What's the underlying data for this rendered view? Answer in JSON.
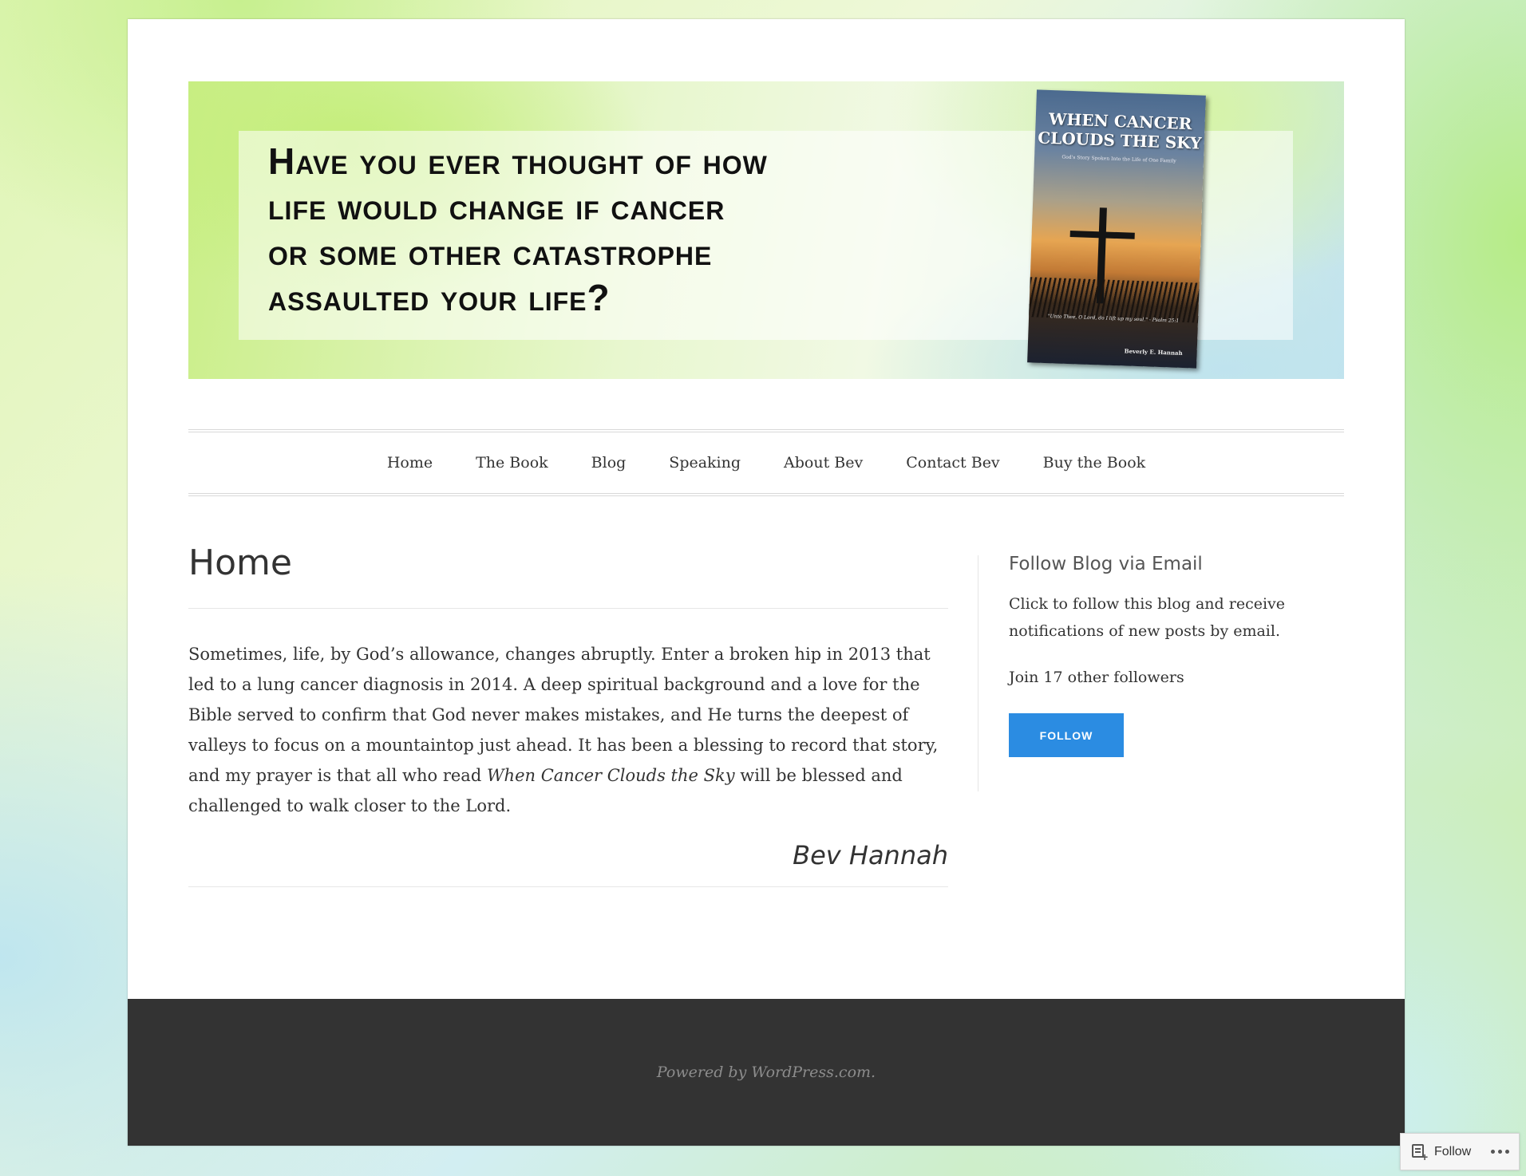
{
  "header": {
    "banner_text": "Have you ever thought of how\nlife would change if cancer\nor some  other catastrophe\nassaulted your life?",
    "book_title": "WHEN CANCER\nCLOUDS THE SKY",
    "book_subtitle": "God's Story Spoken Into the Life of One Family",
    "book_quote": "\"Unto Thee, O Lord, do I lift up my soul.\" - Psalm 25:1",
    "book_author": "Beverly E. Hannah"
  },
  "nav": {
    "items": [
      {
        "label": "Home"
      },
      {
        "label": "The Book"
      },
      {
        "label": "Blog"
      },
      {
        "label": "Speaking"
      },
      {
        "label": "About Bev"
      },
      {
        "label": "Contact Bev"
      },
      {
        "label": "Buy the Book"
      }
    ]
  },
  "main": {
    "title": "Home",
    "body_part1": "Sometimes, life, by God’s allowance, changes abruptly.  Enter a broken hip in 2013 that led to a lung cancer diagnosis in 2014.  A deep spiritual background and a love for the Bible served to confirm that God never makes mistakes, and He turns the deepest of valleys to focus on a mountaintop just ahead.  It has been a blessing to record that story, and my prayer is that all who read ",
    "body_book_title": "When Cancer Clouds the Sky",
    "body_part2": " will be blessed and challenged to walk closer to the Lord.",
    "signature": "Bev Hannah"
  },
  "sidebar": {
    "widget_title": "Follow Blog via Email",
    "widget_text": "Click to follow this blog and receive notifications of new posts by email.",
    "followers_text": "Join 17 other followers",
    "follow_button": "FOLLOW"
  },
  "footer": {
    "powered_by": "Powered by WordPress.com."
  },
  "follow_bar": {
    "label": "Follow"
  },
  "colors": {
    "accent": "#2b8ce2",
    "footer_bg": "#333333"
  }
}
